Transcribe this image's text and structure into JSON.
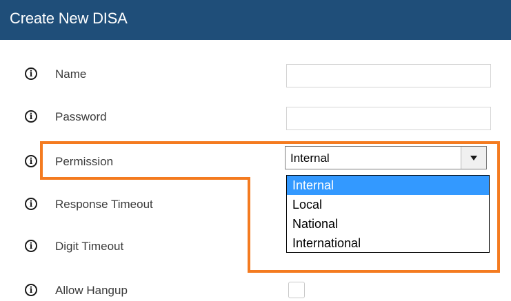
{
  "header": {
    "title": "Create New DISA"
  },
  "fields": [
    {
      "label": "Name",
      "value": ""
    },
    {
      "label": "Password",
      "value": ""
    },
    {
      "label": "Permission"
    },
    {
      "label": "Response Timeout"
    },
    {
      "label": "Digit Timeout"
    },
    {
      "label": "Allow Hangup",
      "checked": false
    }
  ],
  "permission_select": {
    "selected": "Internal",
    "options": [
      "Internal",
      "Local",
      "National",
      "International"
    ],
    "highlighted_option": "Internal"
  },
  "icons": {
    "info": "info-circle-icon",
    "dropdown_arrow": "chevron-down-icon"
  },
  "colors": {
    "header_bg": "#1f4e79",
    "highlight_outline": "#f47b20",
    "selected_option_bg": "#3399ff"
  }
}
